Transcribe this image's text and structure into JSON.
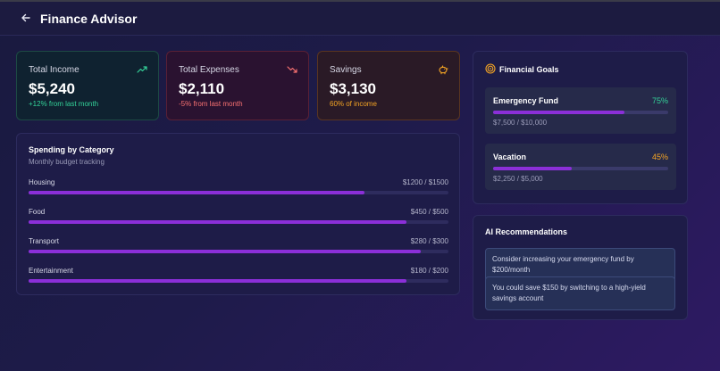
{
  "header": {
    "title": "Finance Advisor"
  },
  "stats": [
    {
      "label": "Total Income",
      "value": "$5,240",
      "note": "+12% from last month",
      "icon": "trending-up-icon",
      "color": "#34d399"
    },
    {
      "label": "Total Expenses",
      "value": "$2,110",
      "note": "-5% from last month",
      "icon": "trending-down-icon",
      "color": "#f87171"
    },
    {
      "label": "Savings",
      "value": "$3,130",
      "note": "60% of income",
      "icon": "piggy-bank-icon",
      "color": "#f5a524"
    }
  ],
  "spending": {
    "title": "Spending by Category",
    "subtitle": "Monthly budget tracking",
    "categories": [
      {
        "name": "Housing",
        "amount": "$1200 / $1500",
        "ratio": 0.8
      },
      {
        "name": "Food",
        "amount": "$450 / $500",
        "ratio": 0.9
      },
      {
        "name": "Transport",
        "amount": "$280 / $300",
        "ratio": 0.933
      },
      {
        "name": "Entertainment",
        "amount": "$180 / $200",
        "ratio": 0.9
      }
    ]
  },
  "goals": {
    "title": "Financial Goals",
    "icon": "target-icon",
    "items": [
      {
        "name": "Emergency Fund",
        "percent": "75%",
        "progress": 0.75,
        "amount": "$7,500 / $10,000",
        "color": "#34d399"
      },
      {
        "name": "Vacation",
        "percent": "45%",
        "progress": 0.45,
        "amount": "$2,250 / $5,000",
        "color": "#f5a524"
      }
    ]
  },
  "ai": {
    "title": "AI Recommendations",
    "items": [
      "Consider increasing your emergency fund by $200/month",
      "You could save $150 by switching to a high-yield savings account"
    ]
  },
  "colors": {
    "accent": "#8b2fd8"
  }
}
